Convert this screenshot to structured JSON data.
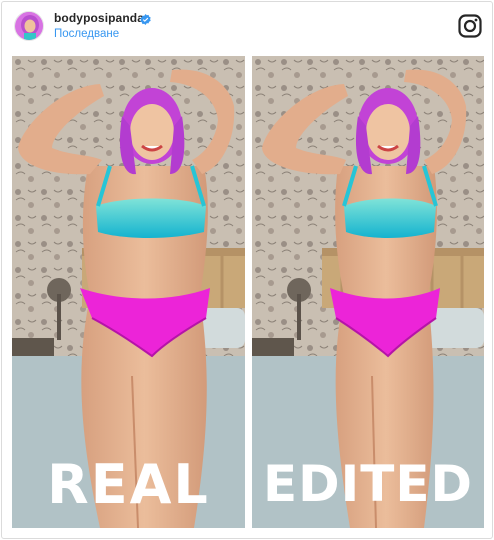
{
  "post": {
    "username": "bodyposipanda",
    "follow_label": "Последване",
    "verified": true
  },
  "images": [
    {
      "label": "REAL"
    },
    {
      "label": "EDITED"
    }
  ],
  "icons": {
    "avatar": "avatar",
    "verified": "verified-badge-icon",
    "app": "instagram-icon"
  },
  "colors": {
    "link": "#3897f0",
    "verified": "#3897f0",
    "text": "#262626"
  }
}
